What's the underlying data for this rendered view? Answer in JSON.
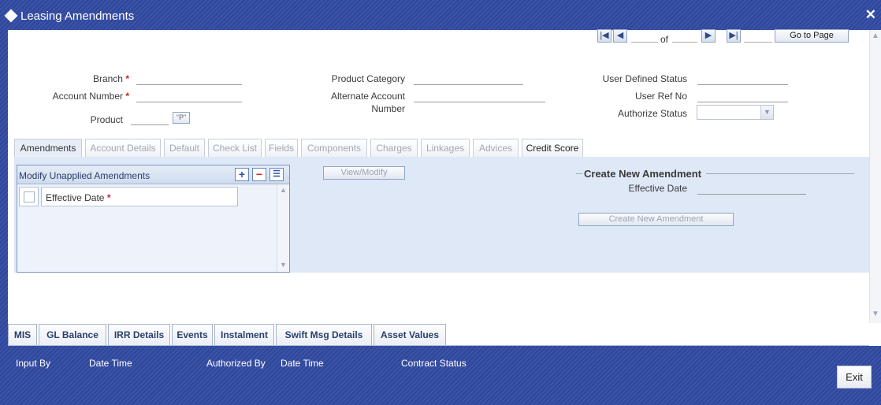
{
  "window": {
    "title": "Leasing Amendments",
    "close_glyph": "✕"
  },
  "navigation": {
    "first_glyph": "|◀",
    "prev_glyph": "◀",
    "next_glyph": "▶",
    "last_glyph": "▶|",
    "of_label": "of",
    "goto_label": "Go to Page"
  },
  "header_form": {
    "branch_label": "Branch",
    "account_number_label": "Account Number",
    "product_label": "Product",
    "product_lov": "\"P\"",
    "product_category_label": "Product Category",
    "alternate_account_label_1": "Alternate Account",
    "alternate_account_label_2": "Number",
    "user_defined_status_label": "User Defined Status",
    "user_ref_no_label": "User Ref No",
    "authorize_status_label": "Authorize Status",
    "required_mark": "*"
  },
  "tabs": [
    {
      "label": "Amendments",
      "active": true
    },
    {
      "label": "Account Details"
    },
    {
      "label": "Default"
    },
    {
      "label": "Check List"
    },
    {
      "label": "Fields"
    },
    {
      "label": "Components"
    },
    {
      "label": "Charges"
    },
    {
      "label": "Linkages"
    },
    {
      "label": "Advices"
    },
    {
      "label": "Credit Score"
    }
  ],
  "amendments": {
    "grid_title": "Modify Unapplied Amendments",
    "add_glyph": "+",
    "remove_glyph": "−",
    "list_glyph": "☰",
    "col_effective_date": "Effective Date",
    "view_modify_label": "View/Modify",
    "create_section_title": "Create New Amendment",
    "create_effective_date_label": "Effective Date",
    "create_button_label": "Create New Amendment"
  },
  "bottom_tabs": [
    "MIS",
    "GL Balance",
    "IRR Details",
    "Events",
    "Instalment",
    "Swift Msg Details",
    "Asset Values"
  ],
  "footer": {
    "input_by": "Input By",
    "date_time_1": "Date Time",
    "authorized_by": "Authorized By",
    "date_time_2": "Date Time",
    "contract_status": "Contract Status",
    "exit_label": "Exit"
  },
  "icons": {
    "up": "▲",
    "down": "▼",
    "select_arrow": "▼"
  },
  "colors": {
    "title_bar": "#3b54a8",
    "required": "#c4262e",
    "panel_bg": "#dfe8f7"
  }
}
